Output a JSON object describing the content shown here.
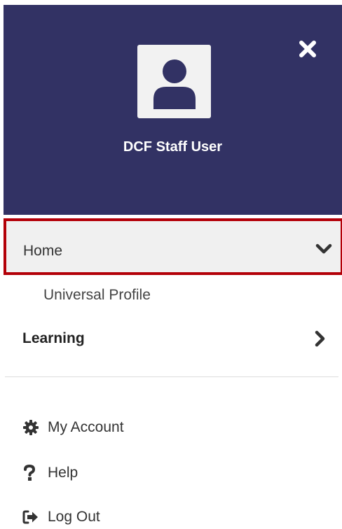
{
  "header": {
    "user_name": "DCF Staff User",
    "background": "#323264",
    "close_icon": "close-icon",
    "avatar_icon": "user-avatar-icon"
  },
  "nav": {
    "home": {
      "label": "Home",
      "icon": "chevron-down-icon",
      "expanded": true,
      "highlight_border": "#b30008"
    },
    "home_children": [
      {
        "label": "Universal Profile"
      }
    ],
    "learning": {
      "label": "Learning",
      "icon": "chevron-right-icon"
    }
  },
  "utility": {
    "my_account": {
      "label": "My Account",
      "icon": "gear-icon"
    },
    "help": {
      "label": "Help",
      "icon": "question-icon"
    },
    "log_out": {
      "label": "Log Out",
      "icon": "sign-out-icon"
    }
  }
}
